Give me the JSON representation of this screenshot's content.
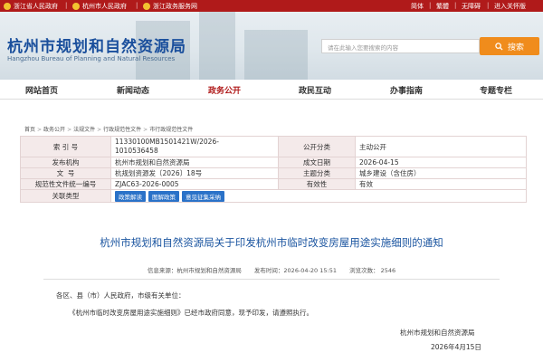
{
  "topbar": {
    "links": [
      "浙江省人民政府",
      "杭州市人民政府",
      "浙江政务服务网"
    ],
    "right": [
      "简体",
      "繁體",
      "无障碍",
      "进入关怀版"
    ]
  },
  "header": {
    "title_cn": "杭州市规划和自然资源局",
    "title_en": "Hangzhou Bureau of Planning and Natural Resources",
    "search_placeholder": "请在此输入您要搜索的内容",
    "search_label": "搜索"
  },
  "nav": [
    "网站首页",
    "新闻动态",
    "政务公开",
    "政民互动",
    "办事指南",
    "专题专栏"
  ],
  "breadcrumb": [
    "首页",
    "政务公开",
    "法规文件",
    "行政规范性文件",
    "市行政规范性文件"
  ],
  "meta": {
    "index_label": "索 引 号",
    "index_value_1": "11330100MB1501421W/2026-",
    "index_value_2": "1010536458",
    "category_label": "公开分类",
    "category_value": "主动公开",
    "issuer_label": "发布机构",
    "issuer_value": "杭州市规划和自然资源局",
    "date_label": "成文日期",
    "date_value": "2026-04-15",
    "docno_label": "文  号",
    "docno_value": "杭规划资源发〔2026〕18号",
    "topic_label": "主题分类",
    "topic_value": "城乡建设（含住房）",
    "code_label": "规范性文件统一编号",
    "code_value": "ZJAC63-2026-0005",
    "valid_label": "有效性",
    "valid_value": "有效",
    "related_label": "关联类型",
    "related_tags": [
      "政策解读",
      "图解政策",
      "意见征集采纳"
    ]
  },
  "article": {
    "title": "杭州市规划和自然资源局关于印发杭州市临时改变房屋用途实施细则的通知",
    "source": "信息来源：杭州市规划和自然资源局",
    "published": "发布时间：2026-04-20 15:51",
    "views": "浏览次数： 2546",
    "salutation": "各区、县（市）人民政府，市级有关单位：",
    "para1": "《杭州市临时改变房屋用途实施细则》已经市政府同意，现予印发，请遵照执行。",
    "signature": "杭州市规划和自然资源局",
    "sign_date": "2026年4月15日"
  }
}
